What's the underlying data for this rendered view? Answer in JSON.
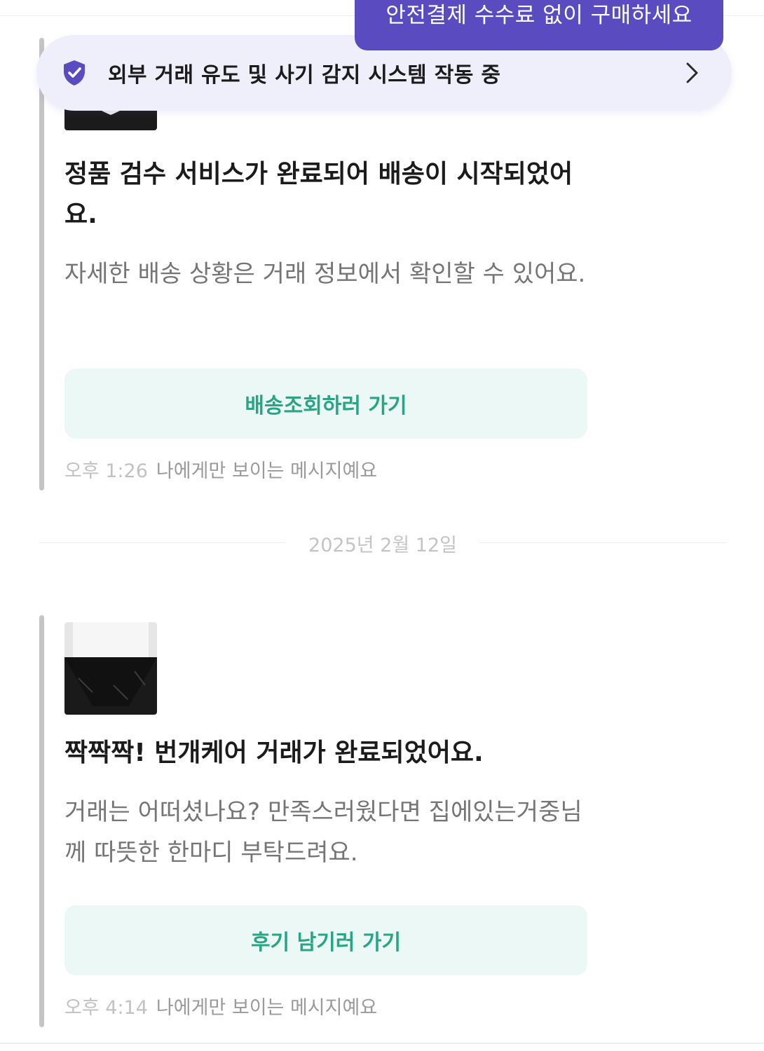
{
  "tooltip": {
    "text": "안전결제 수수료 없이 구매하세요",
    "color": "#5a4cc0"
  },
  "banner": {
    "label": "외부 거래 유도 및 사기 감지 시스템 작동 중",
    "icon": "shield-check-icon",
    "chevron": "chevron-right-icon",
    "background": "#efeffb"
  },
  "messages": [
    {
      "title": "정품 검수 서비스가 완료되어 배송이 시작되었어요.",
      "body": "자세한 배송 상황은 거래 정보에서 확인할 수 있어요.",
      "button_label": "배송조회하러 가기",
      "time": "오후 1:26",
      "visibility_note": "나에게만 보이는 메시지예요",
      "thumbnail": "product-thumbnail"
    },
    {
      "title": "짝짝짝! 번개케어 거래가 완료되었어요.",
      "body": "거래는 어떠셨나요? 만족스러웠다면 집에있는거중님께 따뜻한 한마디 부탁드려요.",
      "button_label": "후기 남기러 가기",
      "time": "오후 4:14",
      "visibility_note": "나에게만 보이는 메시지예요",
      "thumbnail": "product-thumbnail"
    }
  ],
  "date_divider": {
    "text": "2025년 2월 12일"
  },
  "colors": {
    "accent_green": "#27a584",
    "button_bg": "#ecf8f5",
    "brand_purple": "#5a4cc0"
  }
}
